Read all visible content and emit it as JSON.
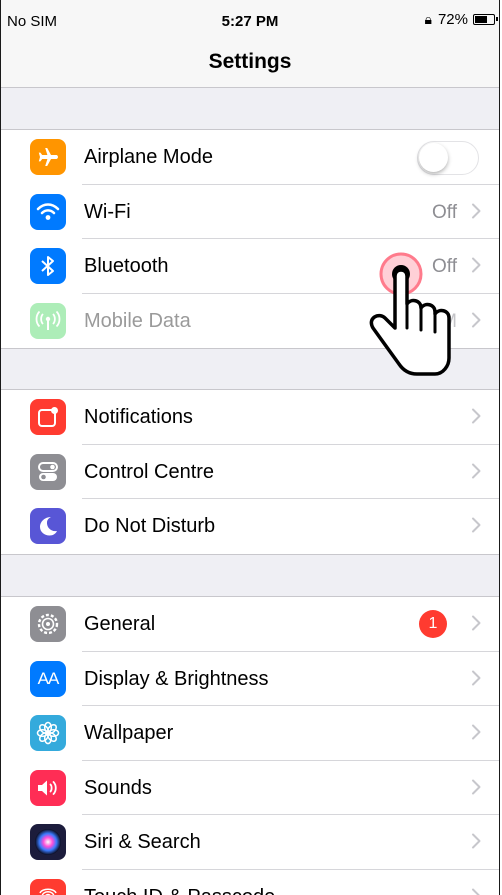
{
  "status_bar": {
    "carrier": "No SIM",
    "time": "5:27 PM",
    "battery_percent": "72%",
    "battery_level": 0.72
  },
  "nav": {
    "title": "Settings"
  },
  "groups": [
    {
      "rows": [
        {
          "label": "Airplane Mode",
          "icon": "airplane-icon",
          "icon_color": "#ff9500",
          "control": "toggle",
          "toggle_on": false
        },
        {
          "label": "Wi-Fi",
          "icon": "wifi-icon",
          "icon_color": "#007aff",
          "value": "Off"
        },
        {
          "label": "Bluetooth",
          "icon": "bluetooth-icon",
          "icon_color": "#007aff",
          "value": "Off"
        },
        {
          "label": "Mobile Data",
          "icon": "antenna-icon",
          "icon_color": "#4cd964",
          "value": "No SIM",
          "disabled": true
        }
      ]
    },
    {
      "rows": [
        {
          "label": "Notifications",
          "icon": "notifications-icon",
          "icon_color": "#ff3b30"
        },
        {
          "label": "Control Centre",
          "icon": "control-centre-icon",
          "icon_color": "#8e8e93"
        },
        {
          "label": "Do Not Disturb",
          "icon": "moon-icon",
          "icon_color": "#5856d6"
        }
      ]
    },
    {
      "rows": [
        {
          "label": "General",
          "icon": "gear-icon",
          "icon_color": "#8e8e93",
          "badge": "1"
        },
        {
          "label": "Display & Brightness",
          "icon": "text-size-icon",
          "icon_color": "#007aff",
          "icon_text": "AA"
        },
        {
          "label": "Wallpaper",
          "icon": "flower-icon",
          "icon_color": "#34aadc"
        },
        {
          "label": "Sounds",
          "icon": "speaker-icon",
          "icon_color": "#ff2d55"
        },
        {
          "label": "Siri & Search",
          "icon": "siri-icon",
          "icon_color": "#1c1c3c"
        },
        {
          "label": "Touch ID & Passcode",
          "icon": "fingerprint-icon",
          "icon_color": "#ff3b30"
        }
      ]
    }
  ]
}
